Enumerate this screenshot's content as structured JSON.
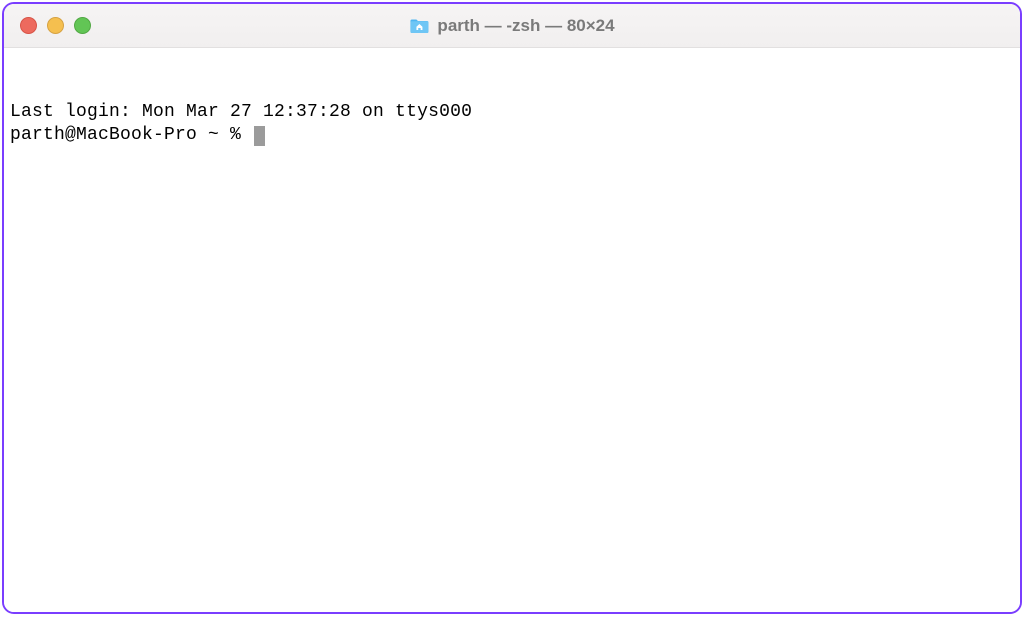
{
  "titlebar": {
    "title": "parth — -zsh — 80×24",
    "icon": "home-folder-icon"
  },
  "terminal": {
    "last_login": "Last login: Mon Mar 27 12:37:28 on ttys000",
    "prompt": "parth@MacBook-Pro ~ % "
  },
  "traffic_lights": {
    "close": "close",
    "minimize": "minimize",
    "maximize": "maximize"
  }
}
